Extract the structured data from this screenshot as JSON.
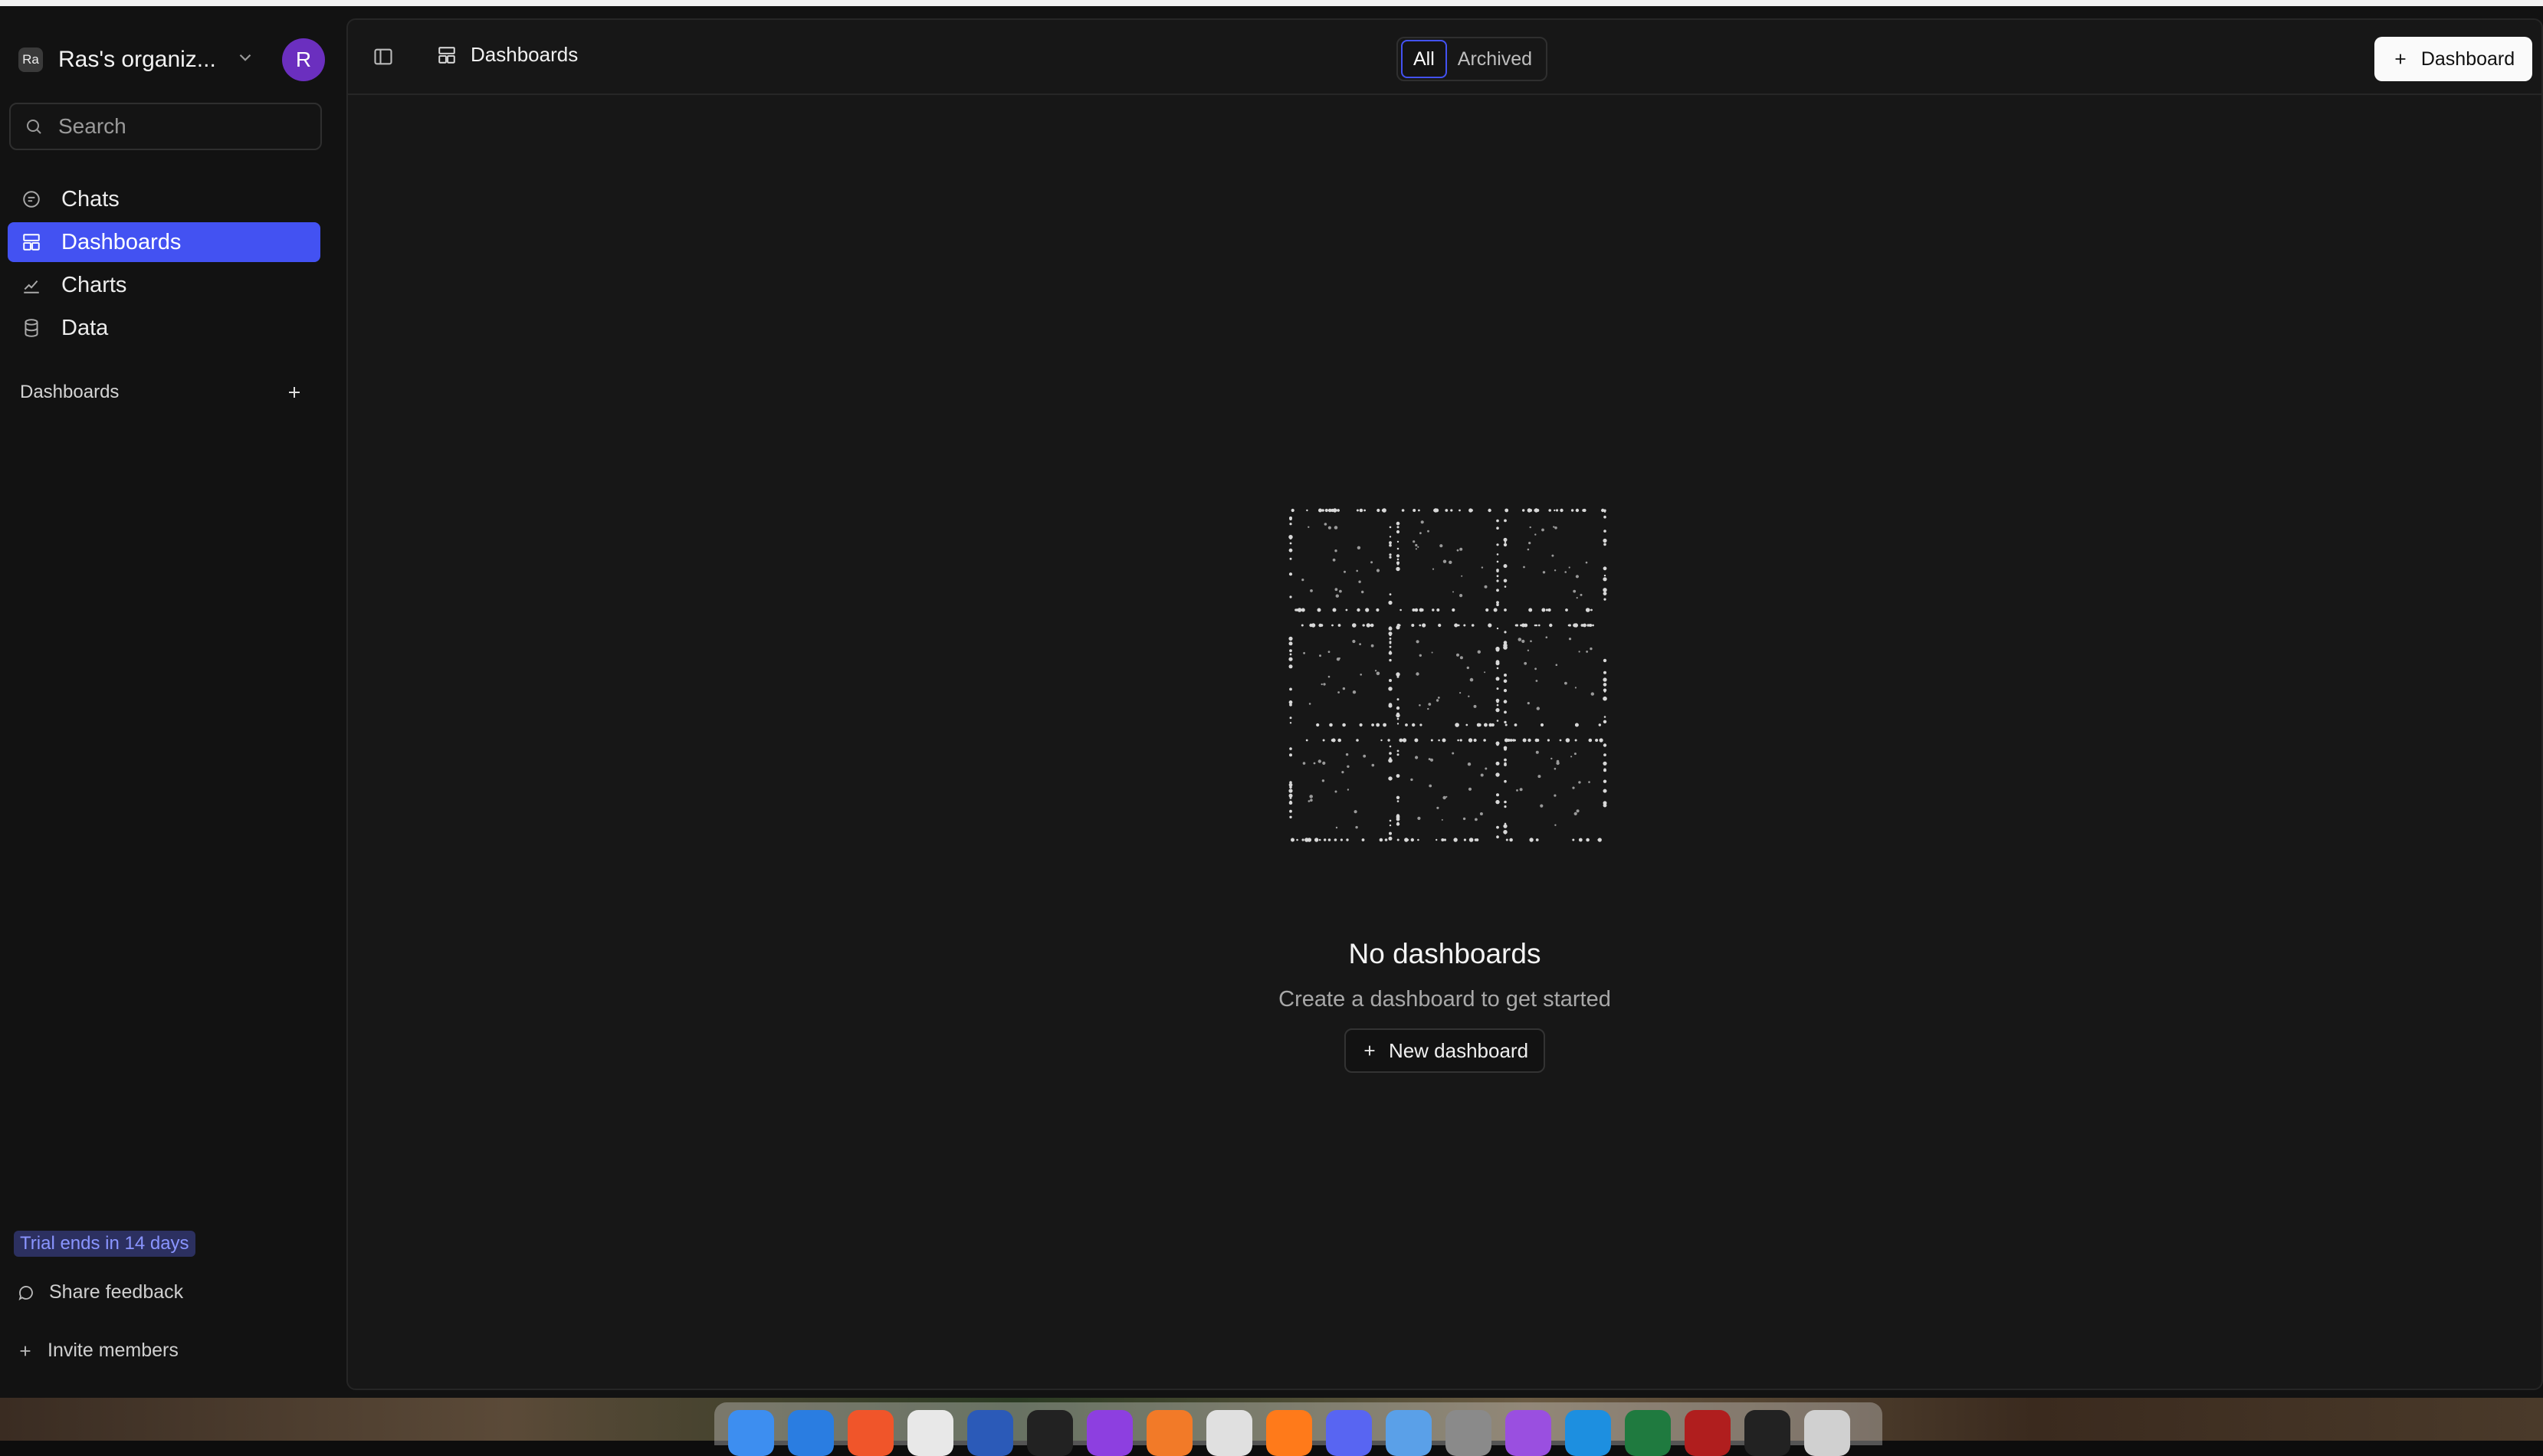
{
  "sidebar": {
    "org_badge": "Ra",
    "org_name": "Ras's organiz...",
    "avatar_initial": "R",
    "search_placeholder": "Search",
    "nav": [
      {
        "label": "Chats",
        "icon": "chat-icon"
      },
      {
        "label": "Dashboards",
        "icon": "dashboard-icon",
        "active": true
      },
      {
        "label": "Charts",
        "icon": "chart-icon"
      },
      {
        "label": "Data",
        "icon": "database-icon"
      }
    ],
    "section_title": "Dashboards",
    "trial_badge": "Trial ends in 14 days",
    "share_feedback": "Share feedback",
    "invite_members": "Invite members"
  },
  "header": {
    "breadcrumb": "Dashboards",
    "filter_tabs": [
      "All",
      "Archived"
    ],
    "active_filter": "All",
    "new_button": "Dashboard"
  },
  "empty_state": {
    "title": "No dashboards",
    "subtitle": "Create a dashboard to get started",
    "button": "New dashboard"
  },
  "colors": {
    "accent": "#4352f2",
    "avatar": "#6b2fbf",
    "background": "#121212",
    "panel": "#171717"
  },
  "dock": {
    "apps": [
      "finder",
      "vscode",
      "brave",
      "chrome",
      "word",
      "cursor",
      "datagrip",
      "sketch",
      "slack",
      "firefox",
      "discord",
      "preview",
      "disk-utility",
      "podcasts",
      "docker",
      "excel",
      "acrobat",
      "terminal",
      "trash"
    ]
  }
}
